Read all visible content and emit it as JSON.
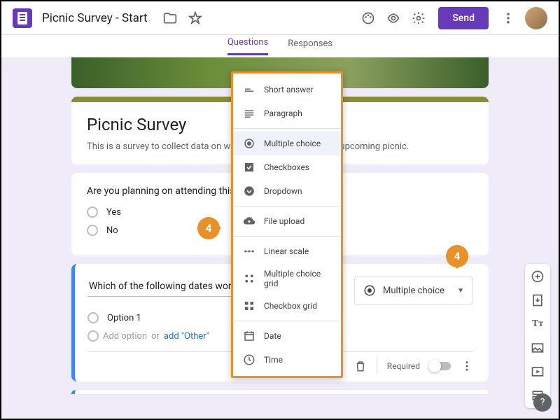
{
  "topbar": {
    "title": "Picnic Survey - Start",
    "send_label": "Send"
  },
  "tabs": {
    "questions": "Questions",
    "responses": "Responses"
  },
  "form": {
    "title": "Picnic Survey",
    "description": "This is a survey to collect data on what everyone wants for the upcoming picnic."
  },
  "q1": {
    "text": "Are you planning on attending this year?",
    "options": [
      "Yes",
      "No"
    ]
  },
  "q2": {
    "text": "Which of the following dates work",
    "option1": "Option 1",
    "add_option": "Add option",
    "or": "or",
    "add_other": "add \"Other\"",
    "type_label": "Multiple choice",
    "required_label": "Required"
  },
  "dropdown": {
    "items": [
      {
        "label": "Short answer"
      },
      {
        "label": "Paragraph"
      },
      {
        "label": "Multiple choice"
      },
      {
        "label": "Checkboxes"
      },
      {
        "label": "Dropdown"
      },
      {
        "label": "File upload"
      },
      {
        "label": "Linear scale"
      },
      {
        "label": "Multiple choice grid"
      },
      {
        "label": "Checkbox grid"
      },
      {
        "label": "Date"
      },
      {
        "label": "Time"
      }
    ]
  },
  "callouts": {
    "c1": "4",
    "c2": "4"
  }
}
